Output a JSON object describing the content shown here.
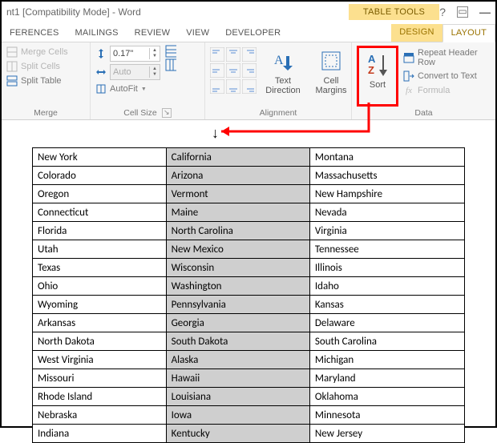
{
  "title": "nt1 [Compatibility Mode] - Word",
  "context_tab_group": "TABLE TOOLS",
  "tabs": {
    "references": "FERENCES",
    "mailings": "MAILINGS",
    "review": "REVIEW",
    "view": "VIEW",
    "developer": "DEVELOPER",
    "design": "DESIGN",
    "layout": "LAYOUT"
  },
  "ribbon": {
    "merge": {
      "merge_cells": "Merge Cells",
      "split_cells": "Split Cells",
      "split_table": "Split Table",
      "label": "Merge"
    },
    "cell_size": {
      "height_value": "0.17\"",
      "width_value": "",
      "auto": "Auto",
      "autofit": "AutoFit",
      "label": "Cell Size"
    },
    "alignment": {
      "text_direction": "Text Direction",
      "cell_margins": "Cell Margins",
      "label": "Alignment"
    },
    "sort": "Sort",
    "data": {
      "repeat_header": "Repeat Header Row",
      "convert_text": "Convert to Text",
      "formula": "Formula",
      "label": "Data"
    }
  },
  "table": [
    [
      "New York",
      "California",
      "Montana"
    ],
    [
      "Colorado",
      "Arizona",
      "Massachusetts"
    ],
    [
      "Oregon",
      "Vermont",
      "New Hampshire"
    ],
    [
      "Connecticut",
      "Maine",
      "Nevada"
    ],
    [
      "Florida",
      "North Carolina",
      "Virginia"
    ],
    [
      "Utah",
      "New Mexico",
      "Tennessee"
    ],
    [
      "Texas",
      "Wisconsin",
      "Illinois"
    ],
    [
      "Ohio",
      "Washington",
      "Idaho"
    ],
    [
      "Wyoming",
      "Pennsylvania",
      "Kansas"
    ],
    [
      "Arkansas",
      "Georgia",
      "Delaware"
    ],
    [
      "North Dakota",
      "South Dakota",
      "South Carolina"
    ],
    [
      "West Virginia",
      "Alaska",
      "Michigan"
    ],
    [
      "Missouri",
      "Hawaii",
      "Maryland"
    ],
    [
      "Rhode Island",
      "Louisiana",
      "Oklahoma"
    ],
    [
      "Nebraska",
      "Iowa",
      "Minnesota"
    ],
    [
      "Indiana",
      "Kentucky",
      "New Jersey"
    ]
  ]
}
